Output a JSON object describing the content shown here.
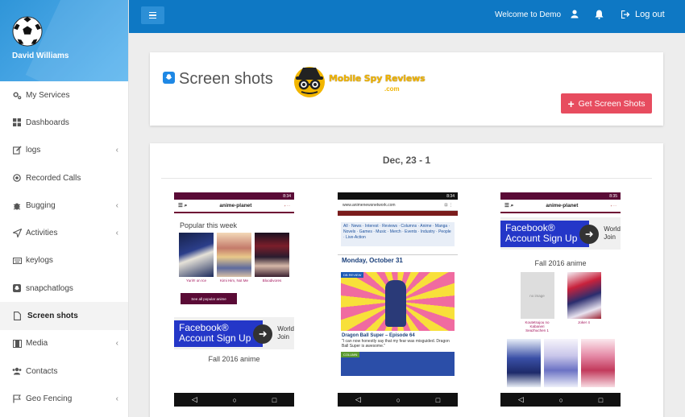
{
  "user": {
    "name": "David Williams"
  },
  "sidebar": {
    "items": [
      {
        "label": "My Services",
        "icon": "cogs-icon",
        "chevron": false
      },
      {
        "label": "Dashboards",
        "icon": "grid-icon",
        "chevron": false
      },
      {
        "label": "logs",
        "icon": "edit-icon",
        "chevron": true
      },
      {
        "label": "Recorded Calls",
        "icon": "record-icon",
        "chevron": false
      },
      {
        "label": "Bugging",
        "icon": "bug-icon",
        "chevron": true
      },
      {
        "label": "Activities",
        "icon": "send-icon",
        "chevron": true
      },
      {
        "label": "keylogs",
        "icon": "keyboard-icon",
        "chevron": false
      },
      {
        "label": "snapchatlogs",
        "icon": "snapchat-icon",
        "chevron": false
      },
      {
        "label": "Screen shots",
        "icon": "file-icon",
        "chevron": false,
        "active": true
      },
      {
        "label": "Media",
        "icon": "film-icon",
        "chevron": true
      },
      {
        "label": "Contacts",
        "icon": "users-icon",
        "chevron": false
      },
      {
        "label": "Geo Fencing",
        "icon": "flag-icon",
        "chevron": true
      }
    ],
    "chevron_glyph": "‹"
  },
  "topbar": {
    "welcome": "Welcome to Demo",
    "logout": "Log out"
  },
  "header": {
    "title": "Screen shots",
    "logo_text": "Mobile Spy Reviews",
    "logo_sub": ".com",
    "button": "Get Screen Shots",
    "button_icon": "+"
  },
  "gallery": {
    "date": "Dec, 23 - 1",
    "shot1": {
      "time": "8:34",
      "site": "anime-planet",
      "heading": "Popular this week",
      "titles": [
        "Yuri!!! on Ice",
        "Kimi Him, Not Me",
        "Bloodivores"
      ],
      "all_button": "See all popular anime",
      "fb_line1": "Facebook®",
      "fb_line2": "Account Sign Up",
      "side_line1": "World",
      "side_line2": "Join",
      "fall": "Fall 2016 anime"
    },
    "shot2": {
      "time": "8:34",
      "url": "www.animenewsnetwork.com",
      "nav": "All · News · Interest · Reviews · Columns · Anime · Manga · Novels · Games · Music · Merch · Events · Industry · People · Live-Action",
      "date": "Monday, October 31",
      "tag": "DB REVIEW",
      "headline": "Dragon Ball Super – Episode 64",
      "quote": "\"I can now honestly say that my fear was misguided. Dragon Ball Super is awesome.\"",
      "tag2": "COLUMN"
    },
    "shot3": {
      "time": "8:35",
      "site": "anime-planet",
      "fb_line1": "Facebook®",
      "fb_line2": "Account Sign Up",
      "side_line1": "World",
      "side_line2": "Join",
      "fall": "Fall 2016 anime",
      "cover1_text": "no image",
      "cap1": "Koutetsujou no Kabaneri Seazhuchen 1",
      "cap2": "Joker 4"
    },
    "nav_back": "◁",
    "nav_home": "○",
    "nav_recent": "□"
  }
}
